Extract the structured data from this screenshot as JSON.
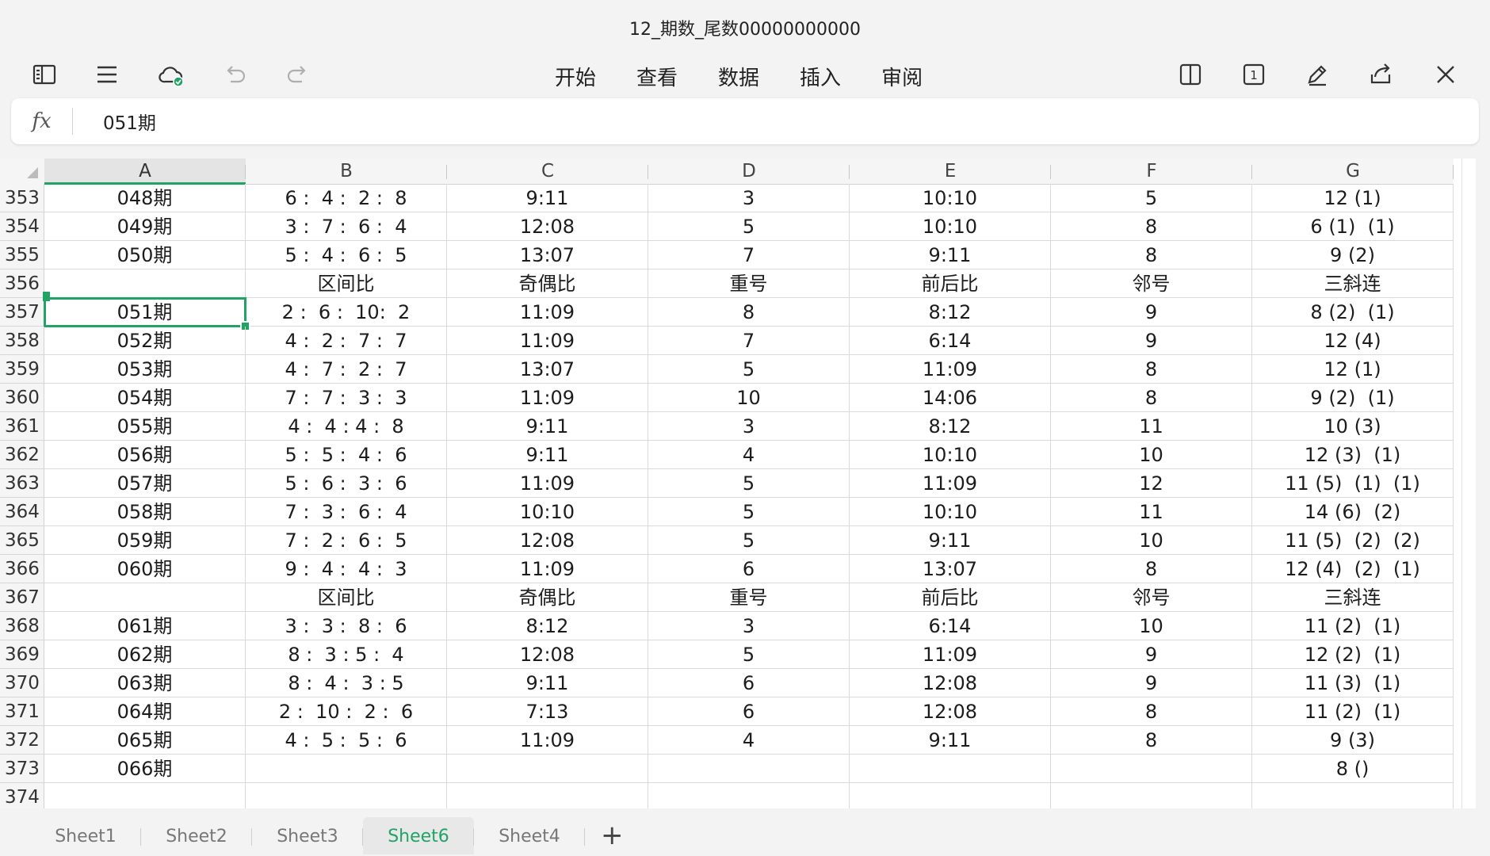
{
  "window": {
    "title": "12_期数_尾数00000000000"
  },
  "toolbar": {
    "left_icons": [
      "sidebar-icon",
      "menu-icon",
      "cloud-sync-icon",
      "undo-icon",
      "redo-icon"
    ],
    "menu": [
      "开始",
      "查看",
      "数据",
      "插入",
      "审阅"
    ],
    "right_icons": [
      "split-view-icon",
      "page-count-icon",
      "pen-icon",
      "share-icon",
      "close-icon"
    ],
    "page_count": "1"
  },
  "formula_bar": {
    "fx_label": "fx",
    "value": "051期"
  },
  "sheet": {
    "columns": [
      "A",
      "B",
      "C",
      "D",
      "E",
      "F",
      "G"
    ],
    "active_column": "A",
    "selected_row": "357",
    "rows": [
      {
        "n": "353",
        "cells": [
          "048期",
          "6 :  4 :  2 :  8",
          "9:11",
          "3",
          "10:10",
          "5",
          "12 (1)"
        ]
      },
      {
        "n": "354",
        "cells": [
          "049期",
          "3 :  7 :  6 :  4",
          "12:08",
          "5",
          "10:10",
          "8",
          "6 (1)  (1)"
        ]
      },
      {
        "n": "355",
        "cells": [
          "050期",
          "5 :  4 :  6 :  5",
          "13:07",
          "7",
          "9:11",
          "8",
          "9 (2)"
        ]
      },
      {
        "n": "356",
        "cells": [
          "",
          "区间比",
          "奇偶比",
          "重号",
          "前后比",
          "邻号",
          "三斜连"
        ]
      },
      {
        "n": "357",
        "cells": [
          "051期",
          "2 :  6 :  10:  2",
          "11:09",
          "8",
          "8:12",
          "9",
          "8 (2)  (1)"
        ]
      },
      {
        "n": "358",
        "cells": [
          "052期",
          "4 :  2 :  7 :  7",
          "11:09",
          "7",
          "6:14",
          "9",
          "12 (4)"
        ]
      },
      {
        "n": "359",
        "cells": [
          "053期",
          "4 :  7 :  2 :  7",
          "13:07",
          "5",
          "11:09",
          "8",
          "12 (1)"
        ]
      },
      {
        "n": "360",
        "cells": [
          "054期",
          "7 :  7 :  3 :  3",
          "11:09",
          "10",
          "14:06",
          "8",
          "9 (2)  (1)"
        ]
      },
      {
        "n": "361",
        "cells": [
          "055期",
          "4 :  4 : 4 :  8",
          "9:11",
          "3",
          "8:12",
          "11",
          "10 (3)"
        ]
      },
      {
        "n": "362",
        "cells": [
          "056期",
          "5 :  5 :  4 :  6",
          "9:11",
          "4",
          "10:10",
          "10",
          "12 (3)  (1)"
        ]
      },
      {
        "n": "363",
        "cells": [
          "057期",
          "5 :  6 :  3 :  6",
          "11:09",
          "5",
          "11:09",
          "12",
          "11 (5)  (1)  (1)"
        ]
      },
      {
        "n": "364",
        "cells": [
          "058期",
          "7 :  3 :  6 :  4",
          "10:10",
          "5",
          "10:10",
          "11",
          "14 (6)  (2)"
        ]
      },
      {
        "n": "365",
        "cells": [
          "059期",
          "7 :  2 :  6 :  5",
          "12:08",
          "5",
          "9:11",
          "10",
          "11 (5)  (2)  (2)"
        ]
      },
      {
        "n": "366",
        "cells": [
          "060期",
          "9 :  4 :  4 :  3",
          "11:09",
          "6",
          "13:07",
          "8",
          "12 (4)  (2)  (1)"
        ]
      },
      {
        "n": "367",
        "cells": [
          "",
          "区间比",
          "奇偶比",
          "重号",
          "前后比",
          "邻号",
          "三斜连"
        ]
      },
      {
        "n": "368",
        "cells": [
          "061期",
          "3 :  3 :  8 :  6",
          "8:12",
          "3",
          "6:14",
          "10",
          "11 (2)  (1)"
        ]
      },
      {
        "n": "369",
        "cells": [
          "062期",
          "8 :  3 : 5 :  4",
          "12:08",
          "5",
          "11:09",
          "9",
          "12 (2)  (1)"
        ]
      },
      {
        "n": "370",
        "cells": [
          "063期",
          "8 :  4 :  3 : 5",
          "9:11",
          "6",
          "12:08",
          "9",
          "11 (3)  (1)"
        ]
      },
      {
        "n": "371",
        "cells": [
          "064期",
          "2 :  10 :  2 :  6",
          "7:13",
          "6",
          "12:08",
          "8",
          "11 (2)  (1)"
        ]
      },
      {
        "n": "372",
        "cells": [
          "065期",
          "4 :  5 :  5 :  6",
          "11:09",
          "4",
          "9:11",
          "8",
          "9 (3)"
        ]
      },
      {
        "n": "373",
        "cells": [
          "066期",
          "",
          "",
          "",
          "",
          "",
          "8 ()"
        ]
      },
      {
        "n": "374",
        "cells": [
          "",
          "",
          "",
          "",
          "",
          "",
          ""
        ]
      }
    ]
  },
  "tabs": {
    "items": [
      "Sheet1",
      "Sheet2",
      "Sheet3",
      "Sheet6",
      "Sheet4"
    ],
    "active": "Sheet6",
    "add_label": "+"
  },
  "colors": {
    "accent": "#21a366",
    "header_bg": "#f5f5f5",
    "grid": "#dadada"
  }
}
